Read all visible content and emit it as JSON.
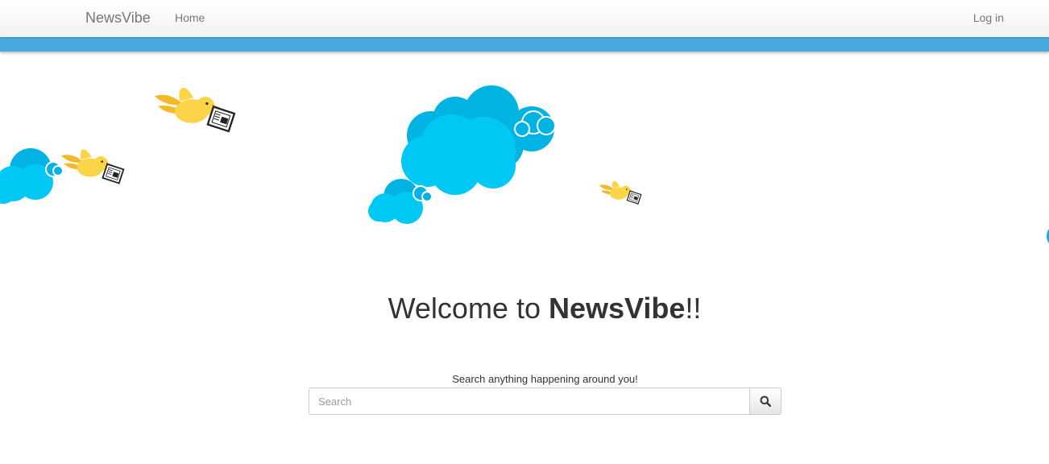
{
  "navbar": {
    "brand": "NewsVibe",
    "home_label": "Home",
    "login_label": "Log in"
  },
  "hero": {
    "welcome_prefix": "Welcome to ",
    "welcome_brand": "NewsVibe",
    "welcome_suffix": "!!"
  },
  "search": {
    "caption": "Search anything happening around you!",
    "placeholder": "Search",
    "value": "",
    "button_icon": "search-icon"
  },
  "colors": {
    "band": "#48a9dd",
    "cloud": "#00c8f5",
    "cloud_dark": "#00b3e3",
    "bird": "#fcd447",
    "bird_wing": "#f5b82a"
  }
}
